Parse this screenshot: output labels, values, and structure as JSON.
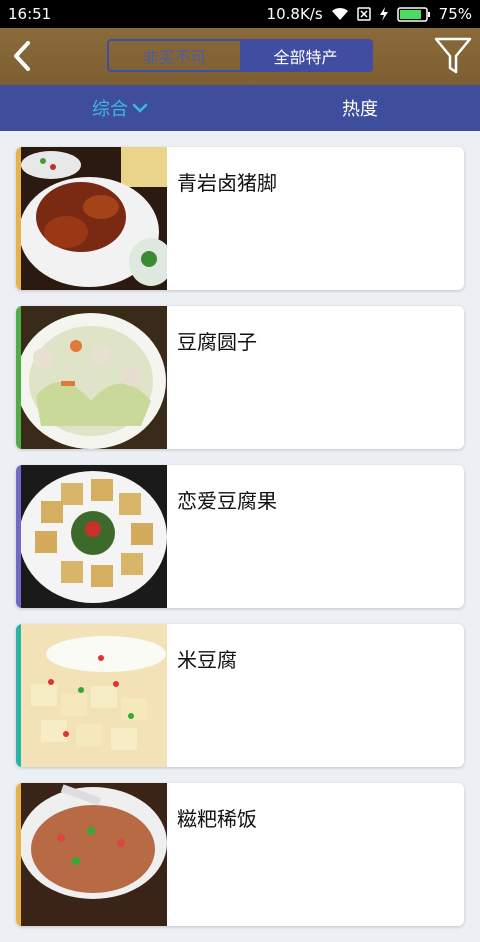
{
  "status_bar": {
    "time": "16:51",
    "speed": "10.8K/s",
    "battery": "75%",
    "icons": [
      "wifi-icon",
      "sim-card-icon",
      "charging-bolt-icon",
      "battery-icon"
    ]
  },
  "header": {
    "back_icon": "chevron-left-icon",
    "segments": [
      "非买不可",
      "全部特产"
    ],
    "active_segment": 1,
    "filter_icon": "funnel-filter-icon",
    "background": "#7f6134",
    "accent": "#3f4ea0"
  },
  "tabs": {
    "items": [
      "综合",
      "热度"
    ],
    "active": 0,
    "active_color": "#3fb5e8",
    "background": "#3e4e9d"
  },
  "list": {
    "items": [
      {
        "title": "青岩卤猪脚",
        "accent": "#e6b24a"
      },
      {
        "title": "豆腐圆子",
        "accent": "#4fae4a"
      },
      {
        "title": "恋爱豆腐果",
        "accent": "#6f6cc6"
      },
      {
        "title": "米豆腐",
        "accent": "#2bb3a8"
      },
      {
        "title": "糍粑稀饭",
        "accent": "#e6b24a"
      }
    ]
  }
}
